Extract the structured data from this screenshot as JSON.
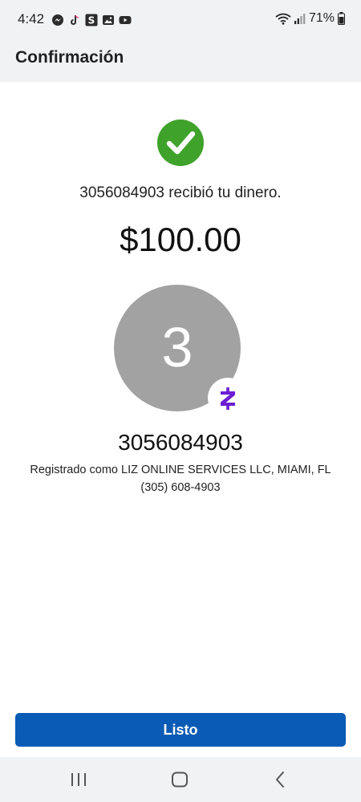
{
  "status_bar": {
    "time": "4:42",
    "battery": "71%",
    "left_icons": [
      "messenger-icon",
      "tiktok-icon",
      "s-app-icon",
      "gallery-icon",
      "youtube-icon"
    ],
    "right_icons": [
      "wifi-icon",
      "signal-icon",
      "battery-icon"
    ]
  },
  "header": {
    "title": "Confirmación"
  },
  "confirmation": {
    "status_icon": "check-circle-icon",
    "message": "3056084903 recibió tu dinero.",
    "amount": "$100.00"
  },
  "recipient": {
    "avatar_initial": "3",
    "badge_icon": "zelle-icon",
    "name": "3056084903",
    "registered": "Registrado como LIZ ONLINE SERVICES LLC, MIAMI, FL",
    "phone": "(305) 608-4903"
  },
  "actions": {
    "done_label": "Listo"
  },
  "nav_bar": {
    "buttons": [
      "recent-apps-icon",
      "home-icon",
      "back-icon"
    ]
  },
  "colors": {
    "accent": "#0a5bb5",
    "success": "#3fa22b",
    "avatar": "#a2a2a2",
    "zelle": "#6d1ed4",
    "bar_background": "#f1f2f4"
  }
}
